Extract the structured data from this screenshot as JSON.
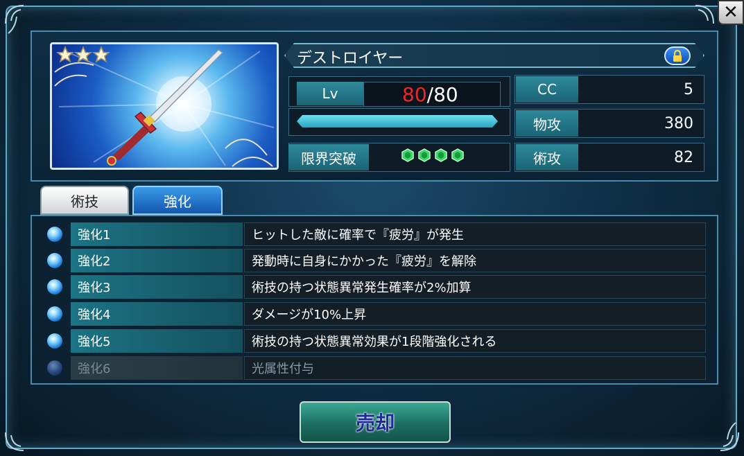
{
  "close_glyph": "✕",
  "weapon": {
    "name": "デストロイヤー",
    "stars": 3,
    "lock_icon": "lock-icon"
  },
  "stats": {
    "lv_label": "Lv",
    "lv_current": "80",
    "lv_max": "/80",
    "exp_fraction": 1.0,
    "limit_break_label": "限界突破",
    "limit_break_gems": 4,
    "cc_label": "CC",
    "cc_value": "5",
    "phys_atk_label": "物攻",
    "phys_atk_value": "380",
    "arts_atk_label": "術攻",
    "arts_atk_value": "82"
  },
  "tabs": [
    {
      "label": "術技",
      "active": false
    },
    {
      "label": "強化",
      "active": true
    }
  ],
  "enhancements": [
    {
      "label": "強化1",
      "desc": "ヒットした敵に確率で『疲労』が発生",
      "unlocked": true
    },
    {
      "label": "強化2",
      "desc": "発動時に自身にかかった『疲労』を解除",
      "unlocked": true
    },
    {
      "label": "強化3",
      "desc": "術技の持つ状態異常発生確率が2%加算",
      "unlocked": true
    },
    {
      "label": "強化4",
      "desc": "ダメージが10%上昇",
      "unlocked": true
    },
    {
      "label": "強化5",
      "desc": "術技の持つ状態異常効果が1段階強化される",
      "unlocked": true
    },
    {
      "label": "強化6",
      "desc": "光属性付与",
      "unlocked": false
    }
  ],
  "sell_label": "売却",
  "colors": {
    "level_red": "#e8282c",
    "accent_teal": "#1c7484",
    "gem_green": "#3ad86a"
  }
}
